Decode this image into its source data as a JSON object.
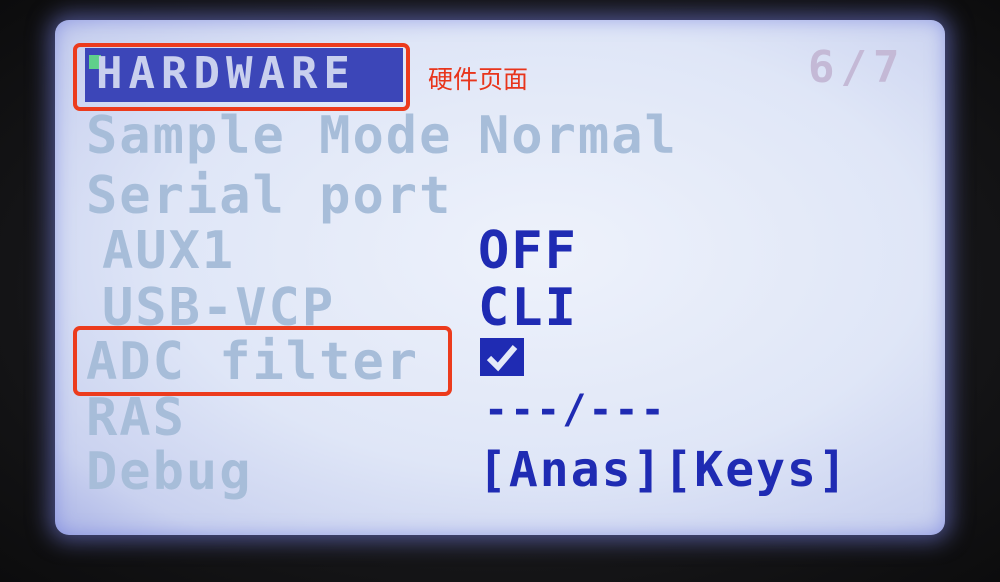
{
  "header": {
    "title": "HARDWARE",
    "page_indicator": "6/7"
  },
  "annotations": {
    "title_note": "硬件页面"
  },
  "settings": [
    {
      "label": "Sample Mode",
      "value": "Normal"
    },
    {
      "label": "Serial port",
      "value": ""
    },
    {
      "label": "AUX1",
      "value": "OFF"
    },
    {
      "label": "USB-VCP",
      "value": "CLI"
    },
    {
      "label": "ADC filter",
      "value": "checked"
    },
    {
      "label": "RAS",
      "value": "---/---"
    },
    {
      "label": "Debug",
      "value": "[Anas][Keys]"
    }
  ],
  "colors": {
    "lcd_background": "#dfe6f7",
    "lcd_text": "#1f2bb3",
    "annotation_red": "#ec3b1d"
  }
}
